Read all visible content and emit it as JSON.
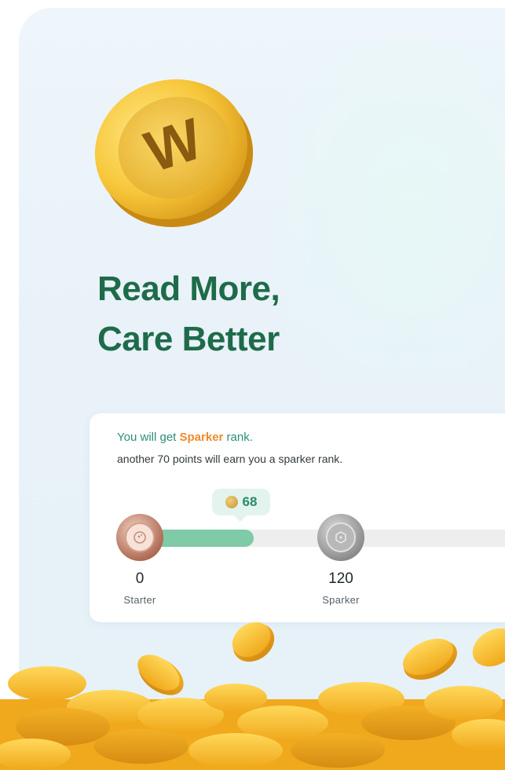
{
  "hero": {
    "coin_icon": "w-coin-icon",
    "coin_letter": "W",
    "title_line1": "Read More,",
    "title_line2": "Care Better"
  },
  "rank": {
    "message_prefix": "You will get ",
    "message_rank": "Sparker",
    "message_suffix": " rank.",
    "subtext": "another 70 points will earn you a sparker rank.",
    "current_points": "68",
    "current_points_value": 68,
    "max_points": 120,
    "levels": [
      {
        "value": "0",
        "name": "Starter"
      },
      {
        "value": "120",
        "name": "Sparker"
      }
    ]
  },
  "colors": {
    "title": "#1e6b4a",
    "accent_green": "#2d8c7a",
    "rank_highlight": "#f08a2c",
    "progress_fill": "#7fcaa7",
    "coin_gold": "#f5c43c"
  }
}
